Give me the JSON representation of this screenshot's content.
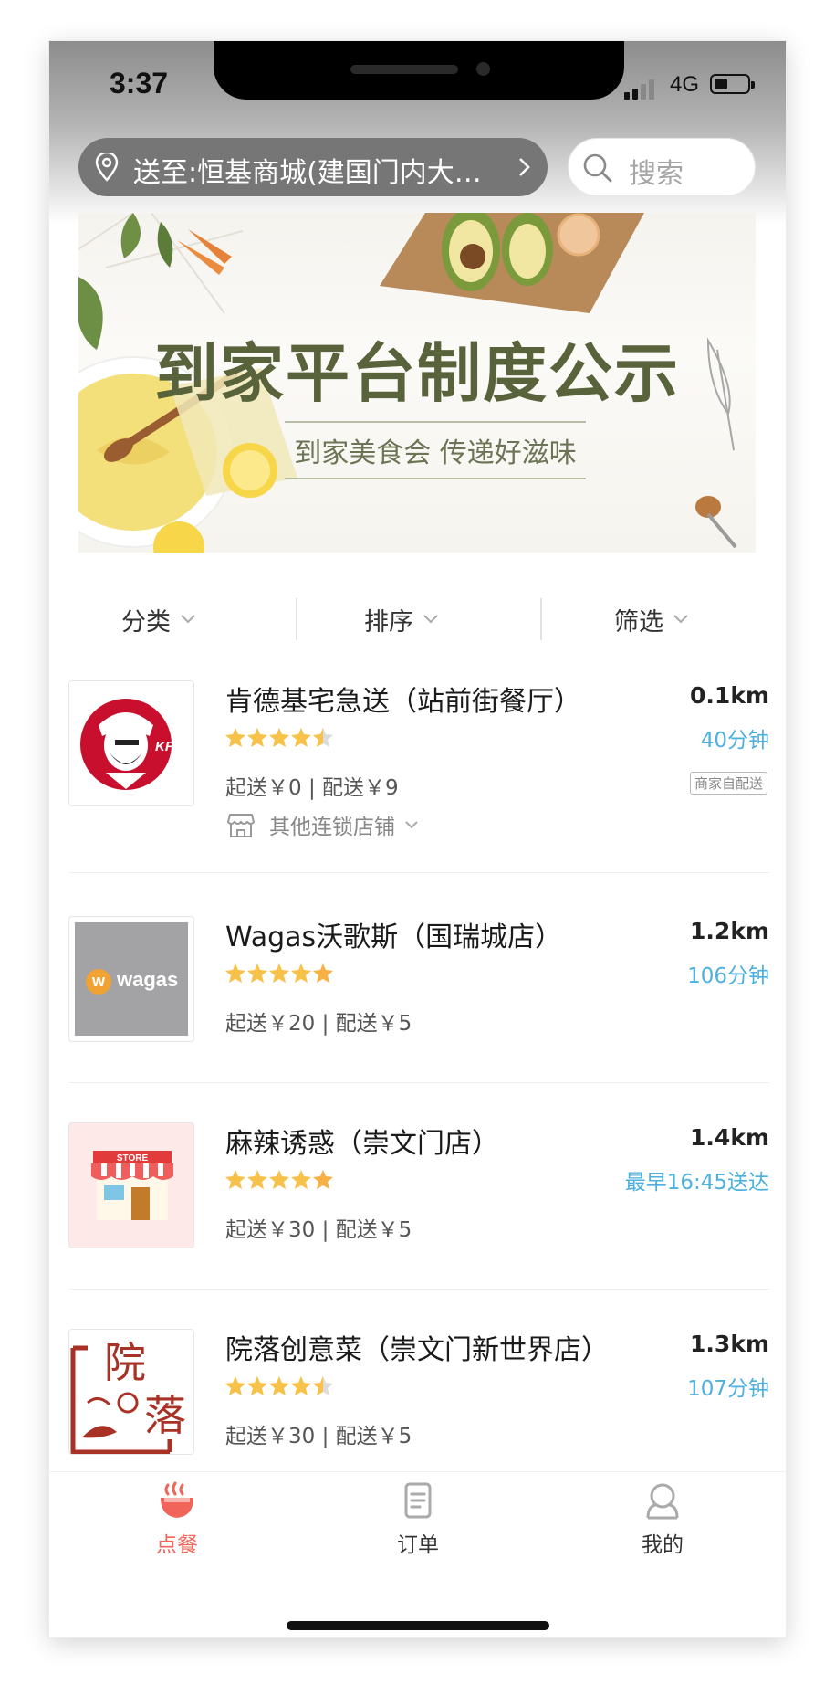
{
  "status_bar": {
    "time": "3:37",
    "network": "4G"
  },
  "header": {
    "address": "送至:恒基商城(建国门内大…",
    "search_placeholder": "搜索"
  },
  "banner": {
    "title": "到家平台制度公示",
    "subtitle": "到家美食会 传递好滋味"
  },
  "filters": [
    {
      "label": "分类"
    },
    {
      "label": "排序"
    },
    {
      "label": "筛选"
    }
  ],
  "stores": [
    {
      "name": "肯德基宅急送（站前街餐厅）",
      "distance": "0.1km",
      "rating": 4.5,
      "eta": "40分钟",
      "fees": "起送￥0 | 配送￥9",
      "badge": "商家自配送",
      "chain_link": "其他连锁店铺",
      "logo": "kfc-logo"
    },
    {
      "name": "Wagas沃歌斯（国瑞城店）",
      "distance": "1.2km",
      "rating": 5,
      "eta": "106分钟",
      "fees": "起送￥20 | 配送￥5",
      "logo": "wagas-logo",
      "logo_text": "wagas"
    },
    {
      "name": "麻辣诱惑（崇文门店）",
      "distance": "1.4km",
      "rating": 5,
      "eta": "最早16:45送达",
      "fees": "起送￥30 | 配送￥5",
      "logo": "store-placeholder-logo",
      "logo_text": "STORE"
    },
    {
      "name": "院落创意菜（崇文门新世界店）",
      "distance": "1.3km",
      "rating": 4.5,
      "eta": "107分钟",
      "fees": "起送￥30 | 配送￥5",
      "logo": "yuanluo-logo",
      "logo_text": "院落"
    }
  ],
  "tabbar": [
    {
      "label": "点餐",
      "icon": "bowl-icon",
      "active": true
    },
    {
      "label": "订单",
      "icon": "order-list-icon",
      "active": false
    },
    {
      "label": "我的",
      "icon": "profile-icon",
      "active": false
    }
  ],
  "colors": {
    "accent_blue": "#4db0de",
    "active_tab": "#f0645a",
    "star": "#f7c24a",
    "address_bg": "#767676"
  }
}
